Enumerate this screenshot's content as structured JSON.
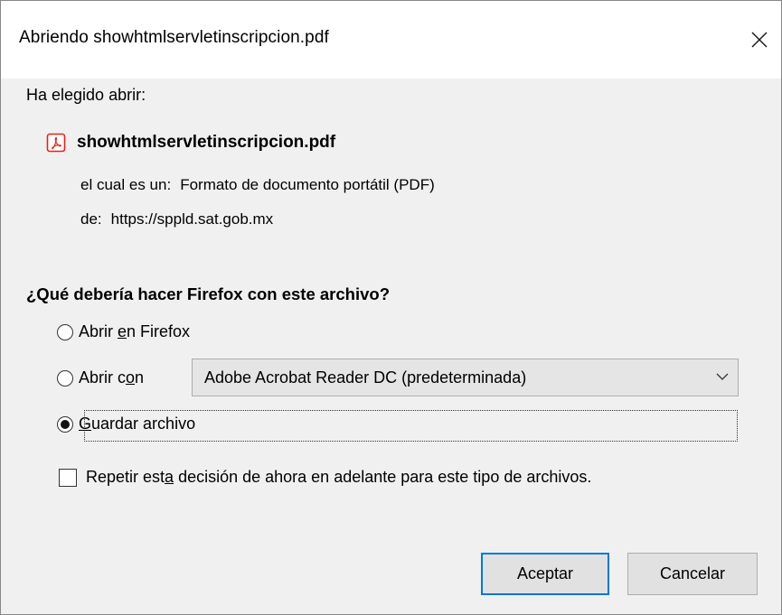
{
  "window": {
    "title": "Abriendo showhtmlservletinscripcion.pdf"
  },
  "file": {
    "intro": "Ha elegido abrir:",
    "name": "showhtmlservletinscripcion.pdf",
    "type_key": "el cual es un:",
    "type_value": "Formato de documento portátil (PDF)",
    "from_key": "de:",
    "from_value": "https://sppld.sat.gob.mx"
  },
  "question": "¿Qué debería hacer Firefox con este archivo?",
  "options": {
    "open_firefox": {
      "pre": "Abrir ",
      "accel": "e",
      "post": "n Firefox",
      "checked": false
    },
    "open_with": {
      "pre": "Abrir c",
      "accel": "o",
      "post": "n",
      "checked": false
    },
    "save": {
      "pre": "",
      "accel": "G",
      "post": "uardar archivo",
      "checked": true
    }
  },
  "app_select": {
    "value": "Adobe Acrobat Reader DC (predeterminada)"
  },
  "remember": {
    "pre": "Repetir est",
    "accel": "a",
    "post": " decisión de ahora en adelante para este tipo de archivos.",
    "checked": false
  },
  "buttons": {
    "accept": "Aceptar",
    "cancel": "Cancelar"
  },
  "icons": {
    "close": "close-icon",
    "pdf": "pdf-file-icon",
    "chevron": "chevron-down-icon"
  },
  "colors": {
    "pdf_red": "#e2231a",
    "focus_blue": "#0078d7"
  }
}
